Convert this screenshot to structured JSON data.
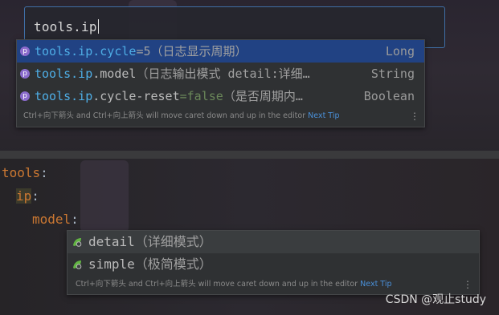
{
  "search": {
    "query": "tools.ip"
  },
  "completion_top": {
    "items": [
      {
        "prefix": "tools.ip",
        "rest": ".cycle",
        "value": "=5",
        "hint": "（日志显示周期）",
        "type": "Long",
        "selected": true
      },
      {
        "prefix": "tools.ip",
        "rest": ".model",
        "value": "",
        "hint": "（日志输出模式 detail:详细…",
        "type": "String",
        "selected": false
      },
      {
        "prefix": "tools.ip",
        "rest": ".cycle-reset",
        "value": "=false",
        "hint": "（是否周期内…",
        "type": "Boolean",
        "selected": false
      }
    ],
    "item_icon_letter": "p",
    "tip_text": "Ctrl+向下箭头 and Ctrl+向上箭头 will move caret down and up in the editor",
    "next_tip": "Next Tip"
  },
  "editor": {
    "lines": [
      {
        "key": "tools",
        "colon": ":"
      },
      {
        "key": "ip",
        "colon": ":"
      },
      {
        "key": "model",
        "colon": ":"
      }
    ]
  },
  "completion_bottom": {
    "items": [
      {
        "label": "detail",
        "hint": "（详细模式）",
        "selected": true
      },
      {
        "label": "simple",
        "hint": "（极简模式）",
        "selected": false
      }
    ],
    "tip_text": "Ctrl+向下箭头 and Ctrl+向上箭头 will move caret down and up in the editor",
    "next_tip": "Next Tip"
  },
  "watermark": "CSDN @观止study",
  "colors": {
    "selection": "#214283",
    "key": "#cc7832",
    "match": "#4eade5",
    "link": "#4a90d9"
  },
  "icons": {
    "property": "property-icon",
    "value": "leaf-value-icon",
    "more": "kebab-menu-icon"
  }
}
